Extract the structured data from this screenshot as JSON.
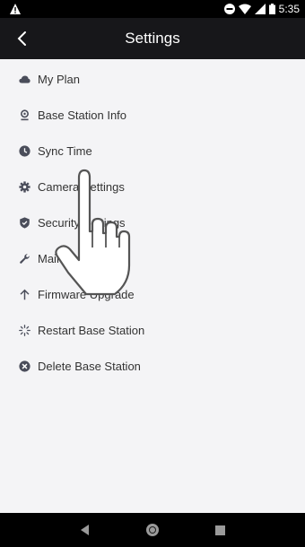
{
  "status_bar": {
    "time": "5:35"
  },
  "header": {
    "title": "Settings"
  },
  "menu": {
    "items": [
      {
        "label": "My Plan",
        "icon": "cloud-icon"
      },
      {
        "label": "Base Station Info",
        "icon": "base-station-icon"
      },
      {
        "label": "Sync Time",
        "icon": "clock-icon"
      },
      {
        "label": "Camera Settings",
        "icon": "gear-icon"
      },
      {
        "label": "Security Settings",
        "icon": "shield-icon"
      },
      {
        "label": "Maintenance",
        "icon": "wrench-icon"
      },
      {
        "label": "Firmware Upgrade",
        "icon": "arrow-up-icon"
      },
      {
        "label": "Restart Base Station",
        "icon": "spinner-icon"
      },
      {
        "label": "Delete Base Station",
        "icon": "delete-circle-icon"
      }
    ]
  },
  "colors": {
    "header_bg": "#17171a",
    "icon": "#4a4d5a",
    "text": "#333333",
    "background": "#f4f4f6"
  }
}
